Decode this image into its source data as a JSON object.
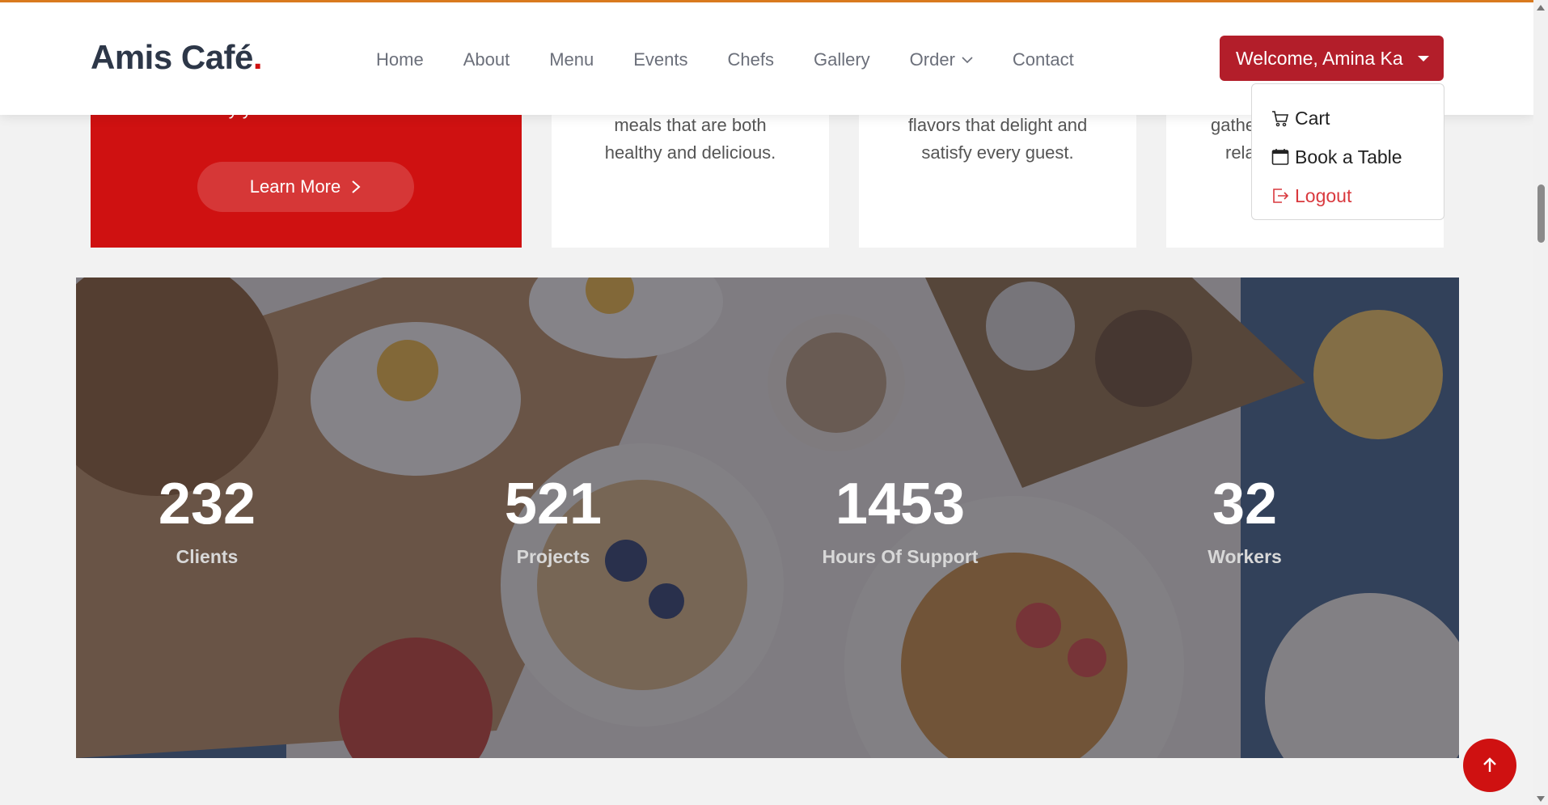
{
  "brand": {
    "name": "Amis Café",
    "dot": "."
  },
  "nav": {
    "items": [
      "Home",
      "About",
      "Menu",
      "Events",
      "Chefs",
      "Gallery",
      "Order",
      "Contact"
    ]
  },
  "user_menu": {
    "welcome_label": "Welcome, Amina Ka",
    "items": [
      {
        "label": "Cart",
        "icon": "cart-icon"
      },
      {
        "label": "Book a Table",
        "icon": "calendar-icon"
      },
      {
        "label": "Logout",
        "icon": "logout-icon"
      }
    ]
  },
  "cards": {
    "red": {
      "clipped_text": "care to satisfy your taste buds.",
      "button_label": "Learn More"
    },
    "card2": {
      "line1": "meals that are both",
      "line2": "healthy and delicious."
    },
    "card3": {
      "line1": "flavors that delight and",
      "line2": "satisfy every guest."
    },
    "card4": {
      "line1": "gathe",
      "line2": "rela"
    }
  },
  "stats": [
    {
      "value": "232",
      "label": "Clients"
    },
    {
      "value": "521",
      "label": "Projects"
    },
    {
      "value": "1453",
      "label": "Hours Of Support"
    },
    {
      "value": "32",
      "label": "Workers"
    }
  ],
  "colors": {
    "accent": "#cf1111",
    "welcome_button": "#b31e2a",
    "top_border": "#d97a1e"
  }
}
